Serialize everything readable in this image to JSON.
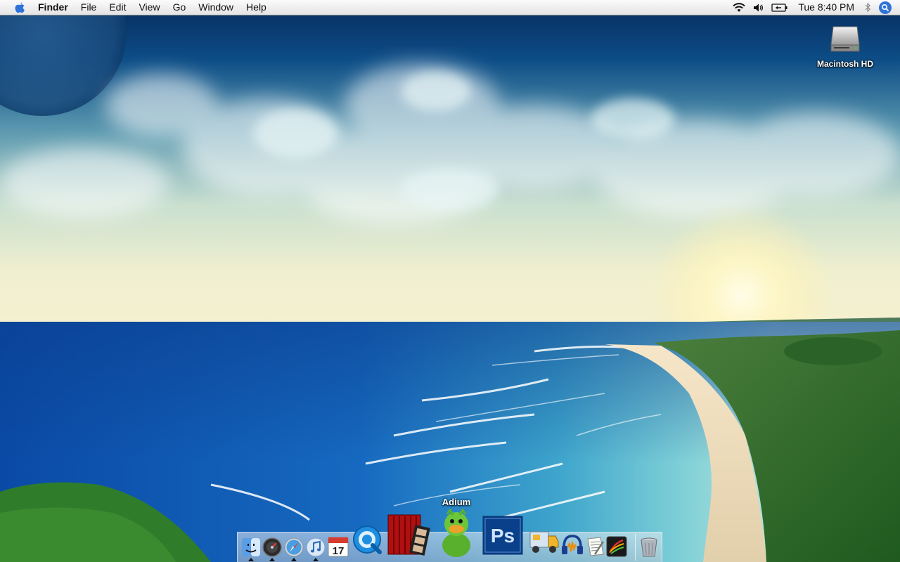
{
  "menubar": {
    "app_name": "Finder",
    "menus": [
      "File",
      "Edit",
      "View",
      "Go",
      "Window",
      "Help"
    ],
    "clock": "Tue 8:40 PM",
    "status_icons": [
      "wifi-icon",
      "volume-icon",
      "battery-icon",
      "bluetooth-icon",
      "spotlight-icon"
    ]
  },
  "desktop": {
    "icons": [
      {
        "label": "Macintosh HD",
        "icon": "hard-drive-icon"
      }
    ]
  },
  "dock": {
    "tooltip": "Adium",
    "apps": [
      {
        "name": "Finder",
        "icon": "finder-icon",
        "running": true
      },
      {
        "name": "Dashboard",
        "icon": "dashboard-icon",
        "running": true
      },
      {
        "name": "Safari",
        "icon": "safari-icon",
        "running": true
      },
      {
        "name": "iTunes",
        "icon": "itunes-icon",
        "running": true
      },
      {
        "name": "iCal",
        "icon": "ical-icon",
        "running": false,
        "badge": "17"
      },
      {
        "name": "QuickTime",
        "icon": "quicktime-icon",
        "running": false
      },
      {
        "name": "Photo Booth",
        "icon": "photo-booth-icon",
        "running": false
      },
      {
        "name": "Adium",
        "icon": "adium-icon",
        "running": false
      },
      {
        "name": "Photoshop",
        "icon": "photoshop-icon",
        "running": false,
        "badge": "Ps"
      },
      {
        "name": "Transmit",
        "icon": "transmit-icon",
        "running": false
      },
      {
        "name": "Audacity",
        "icon": "audacity-icon",
        "running": false
      },
      {
        "name": "TextEdit",
        "icon": "textedit-icon",
        "running": false
      },
      {
        "name": "iLife App",
        "icon": "ilife-app-icon",
        "running": false
      },
      {
        "name": "Trash",
        "icon": "trash-icon",
        "running": false
      }
    ]
  },
  "colors": {
    "sky_top": "#0a3c78",
    "ocean": "#1261b8",
    "sand": "#ecd9b7",
    "forest": "#2f6b2a",
    "spotlight_blue": "#2f73d8"
  }
}
